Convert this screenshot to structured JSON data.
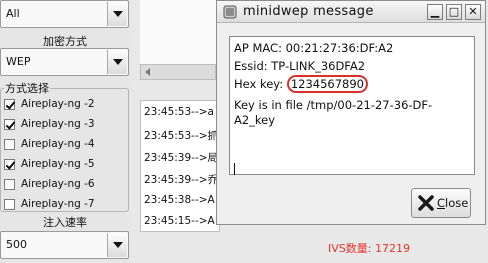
{
  "left_panel": {
    "interface_combo": "All",
    "encryption_heading": "加密方式",
    "encryption_combo": "WEP",
    "method_group_title": "方式选择",
    "methods": [
      {
        "label": "Aireplay-ng -2",
        "checked": true
      },
      {
        "label": "Aireplay-ng -3",
        "checked": true
      },
      {
        "label": "Aireplay-ng -4",
        "checked": false
      },
      {
        "label": "Aireplay-ng -5",
        "checked": true
      },
      {
        "label": "Aireplay-ng -6",
        "checked": false
      },
      {
        "label": "Aireplay-ng -7",
        "checked": false
      }
    ],
    "rate_heading": "注入速率",
    "rate_combo": "500"
  },
  "log": {
    "lines": [
      "23:45:53-->a",
      "23:45:53-->抓",
      "23:45:39-->局",
      "23:45:39-->乔",
      "23:45:38-->A",
      "23:45:15-->A"
    ]
  },
  "ivs_status": "IVS数量: 17219",
  "dialog": {
    "title": "minidwep message",
    "ap_mac": "AP MAC: 00:21:27:36:DF:A2",
    "essid": "Essid: TP-LINK_36DFA2",
    "hex_key_label": "Hex key:",
    "hex_key_value": "1234567890",
    "key_file_line1": "Key is in file /tmp/00-21-27-36-DF-",
    "key_file_line2": "A2_key",
    "close_label_underlined": "C",
    "close_label_rest": "lose"
  },
  "colors": {
    "ivs_text": "#e8352a",
    "hex_highlight": "#d6312a",
    "close_icon": "#1a1a1a"
  }
}
